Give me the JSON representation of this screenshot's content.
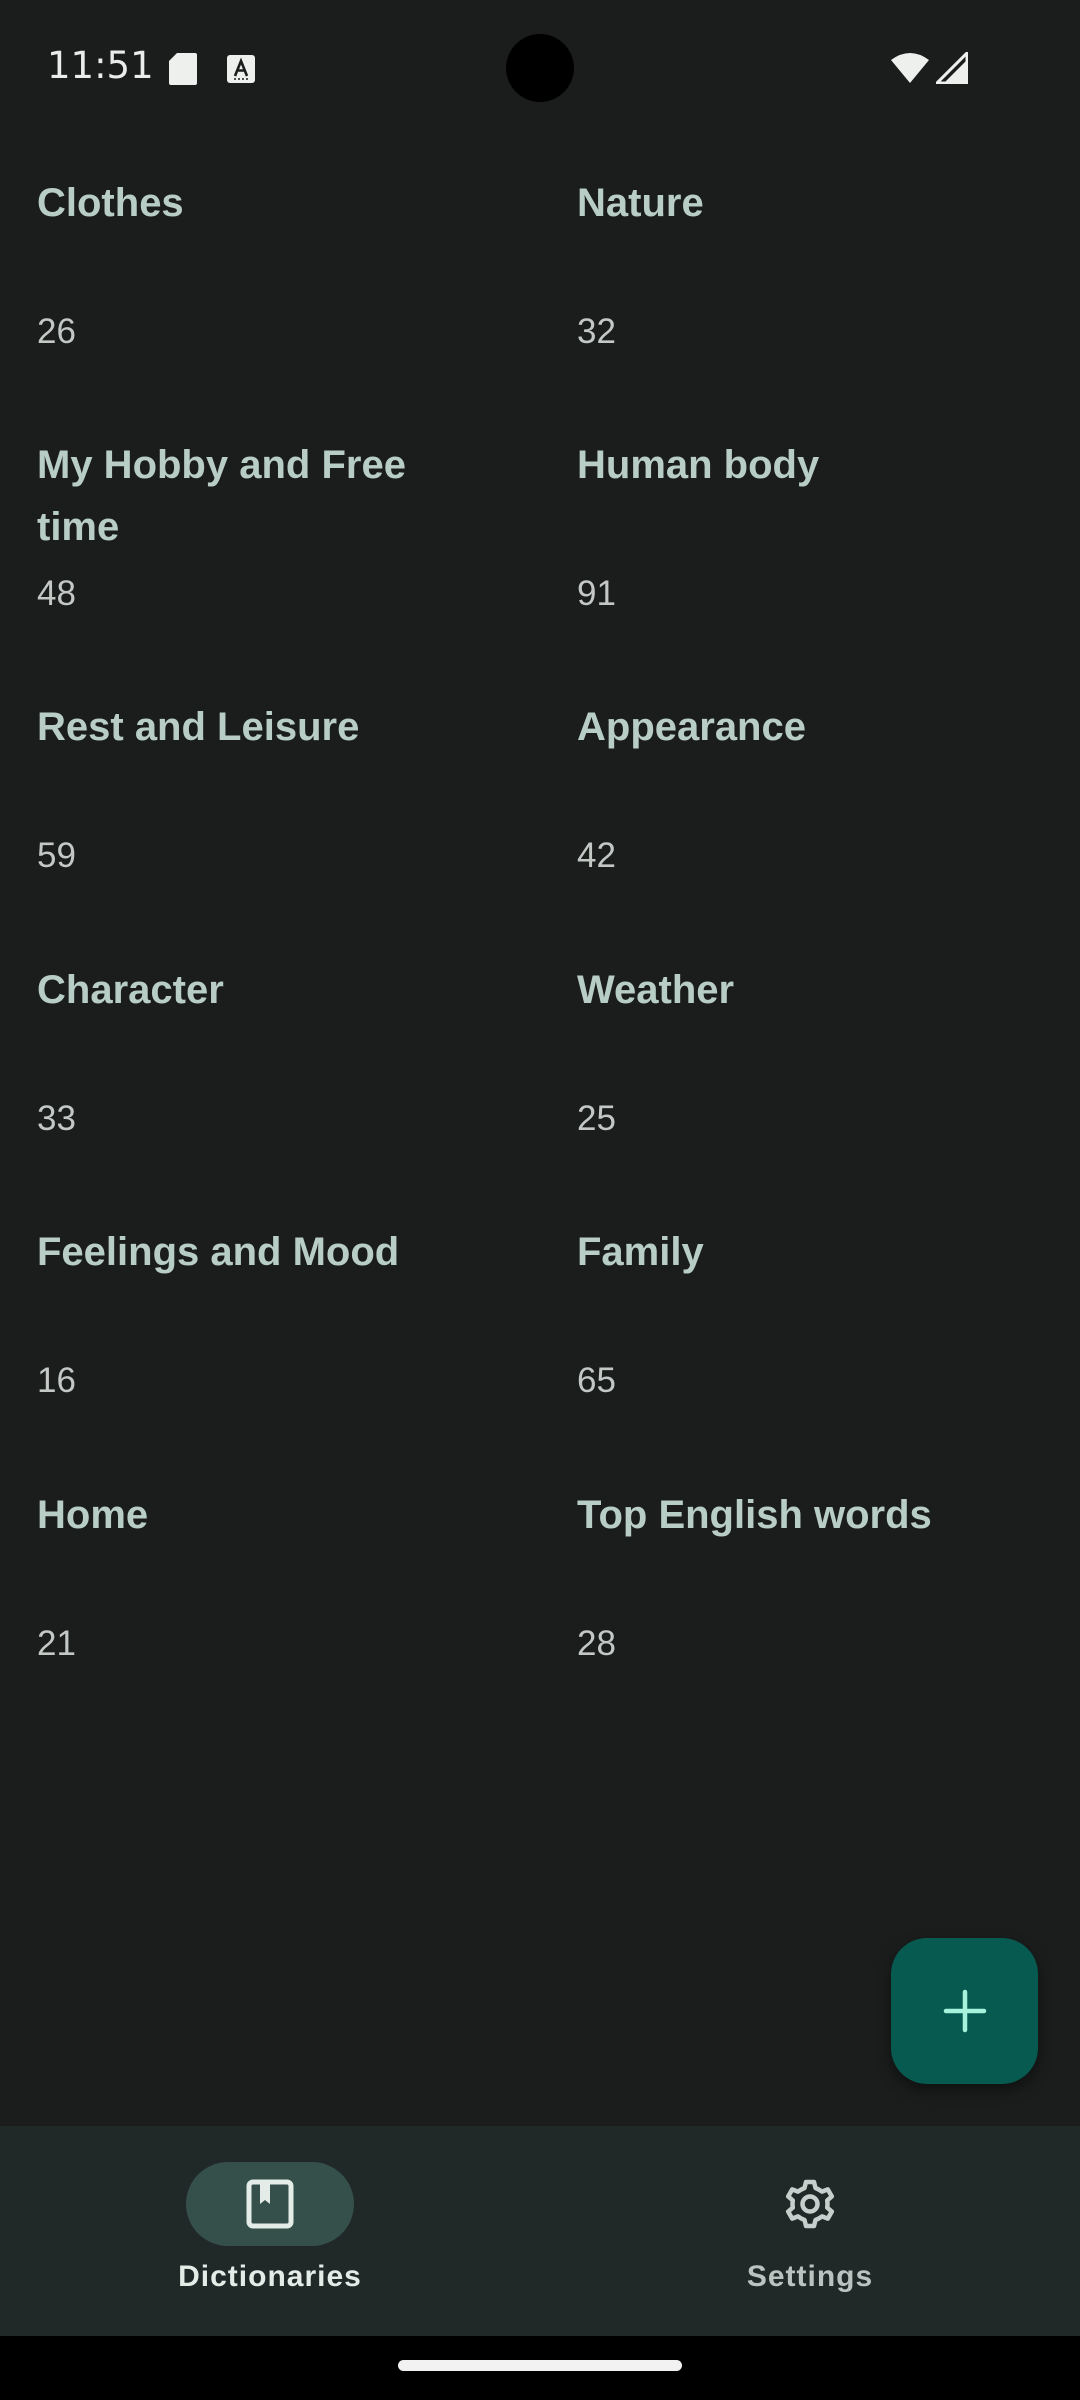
{
  "status_bar": {
    "time": "11:51"
  },
  "dictionaries": [
    {
      "title": "Clothes",
      "count": "26"
    },
    {
      "title": "Nature",
      "count": "32"
    },
    {
      "title": "My Hobby and Free time",
      "count": "48"
    },
    {
      "title": "Human body",
      "count": "91"
    },
    {
      "title": "Rest and Leisure",
      "count": "59"
    },
    {
      "title": "Appearance",
      "count": "42"
    },
    {
      "title": "Character",
      "count": "33"
    },
    {
      "title": "Weather",
      "count": "25"
    },
    {
      "title": "Feelings and Mood",
      "count": "16"
    },
    {
      "title": "Family",
      "count": "65"
    },
    {
      "title": "Home",
      "count": "21"
    },
    {
      "title": "Top English words",
      "count": "28"
    }
  ],
  "fab": {
    "icon": "plus-icon"
  },
  "bottom_nav": {
    "items": [
      {
        "label": "Dictionaries",
        "icon": "book-icon",
        "active": true
      },
      {
        "label": "Settings",
        "icon": "gear-icon",
        "active": false
      }
    ]
  },
  "colors": {
    "background": "#1b1d1d",
    "title": "#b8cdc6",
    "count": "#c3c8c5",
    "fab": "#065a50",
    "fab_icon": "#a7f2dc",
    "nav_background": "#202828",
    "nav_active_pill": "#35504a"
  }
}
